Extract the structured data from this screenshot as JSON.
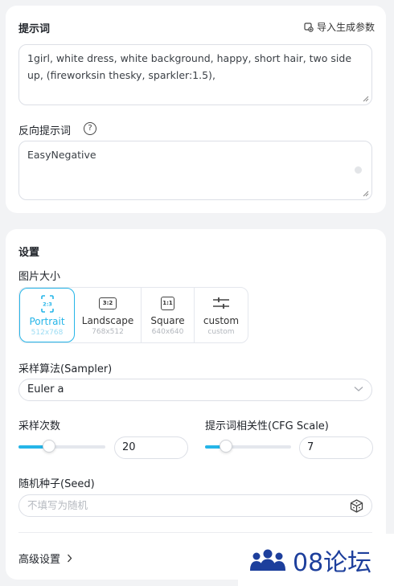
{
  "prompt_section": {
    "title": "提示词",
    "import_label": "导入生成参数",
    "prompt_text": "1girl, white dress, white background, happy,  short hair, two side up,  (fireworksin thesky, sparkler:1.5),"
  },
  "negative_section": {
    "title": "反向提示词",
    "help_icon": "question-circle-icon",
    "text": "EasyNegative"
  },
  "settings": {
    "title": "设置",
    "image_size_label": "图片大小",
    "size_options": [
      {
        "ratio": "2:3",
        "name": "Portrait",
        "dims": "512x768",
        "selected": true
      },
      {
        "ratio": "3:2",
        "name": "Landscape",
        "dims": "768x512",
        "selected": false
      },
      {
        "ratio": "1:1",
        "name": "Square",
        "dims": "640x640",
        "selected": false
      },
      {
        "ratio": "",
        "name": "custom",
        "dims": "custom",
        "selected": false
      }
    ],
    "sampler_label": "采样算法(Sampler)",
    "sampler_value": "Euler a",
    "steps_label": "采样次数",
    "steps_value": "20",
    "cfg_label": "提示词相关性(CFG Scale)",
    "cfg_value": "7",
    "seed_label": "随机种子(Seed)",
    "seed_placeholder": "不填写为随机",
    "advanced_label": "高级设置"
  },
  "watermark": {
    "text": "08论坛"
  },
  "colors": {
    "accent": "#25b5e8",
    "brand_watermark": "#1d3f9c"
  }
}
